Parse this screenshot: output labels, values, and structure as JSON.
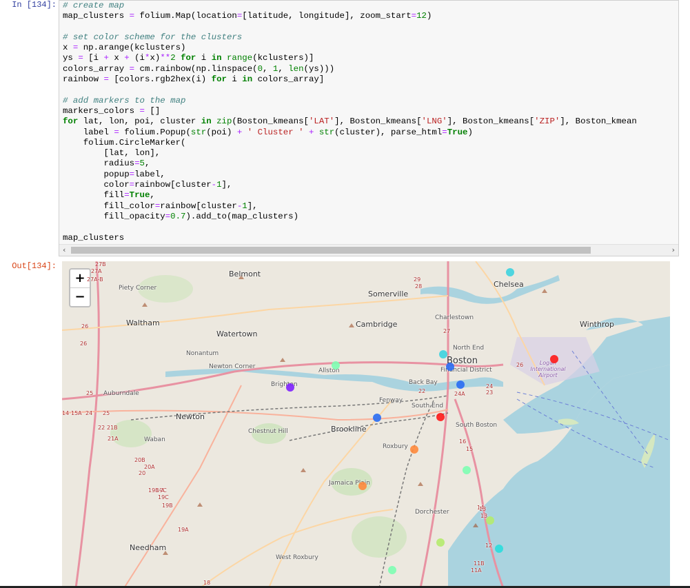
{
  "prompts": {
    "in": "In [134]:",
    "out": "Out[134]:"
  },
  "map": {
    "zoom_in": "+",
    "zoom_out": "−",
    "places": [
      {
        "name": "Belmont"
      },
      {
        "name": "Somerville"
      },
      {
        "name": "Chelsea"
      },
      {
        "name": "Piety Corner"
      },
      {
        "name": "Waltham"
      },
      {
        "name": "Cambridge"
      },
      {
        "name": "Charlestown"
      },
      {
        "name": "Winthrop"
      },
      {
        "name": "Watertown"
      },
      {
        "name": "North End"
      },
      {
        "name": "Nonantum"
      },
      {
        "name": "Newton Corner"
      },
      {
        "name": "Allston"
      },
      {
        "name": "Boston"
      },
      {
        "name": "Financial District"
      },
      {
        "name": "Logan International Airport"
      },
      {
        "name": "Brighton"
      },
      {
        "name": "Back Bay"
      },
      {
        "name": "Auburndale"
      },
      {
        "name": "Fenway"
      },
      {
        "name": "South End"
      },
      {
        "name": "Newton"
      },
      {
        "name": "Chestnut Hill"
      },
      {
        "name": "Brookline"
      },
      {
        "name": "South Boston"
      },
      {
        "name": "Waban"
      },
      {
        "name": "Roxbury"
      },
      {
        "name": "Jamaica Plain"
      },
      {
        "name": "Dorchester"
      },
      {
        "name": "Needham"
      },
      {
        "name": "West Roxbury"
      }
    ],
    "route_labels": [
      "27B",
      "27A",
      "27A-B",
      "26",
      "26",
      "25",
      "14",
      "15A",
      "24",
      "25",
      "22",
      "21B",
      "21A",
      "20B",
      "20A",
      "20",
      "19C",
      "19B-A",
      "19B",
      "19C",
      "19A",
      "18",
      "29",
      "28",
      "27",
      "26",
      "24A",
      "24",
      "23",
      "22",
      "16",
      "15",
      "14",
      "13",
      "12",
      "11B",
      "11A",
      "13"
    ],
    "markers": [
      {
        "color": "#3fd3e0"
      },
      {
        "color": "#ff1a1a"
      },
      {
        "color": "#3fd3e0"
      },
      {
        "color": "#2a6df4"
      },
      {
        "color": "#2a6df4"
      },
      {
        "color": "#7f22ff"
      },
      {
        "color": "#2a6df4"
      },
      {
        "color": "#ff1a1a"
      },
      {
        "color": "#ff8a3d"
      },
      {
        "color": "#ff8a3d"
      },
      {
        "color": "#7fffb3"
      },
      {
        "color": "#b5ec6e"
      },
      {
        "color": "#b5ec6e"
      },
      {
        "color": "#7fffb3"
      },
      {
        "color": "#2adddd"
      },
      {
        "color": "#7fffb3"
      }
    ]
  }
}
